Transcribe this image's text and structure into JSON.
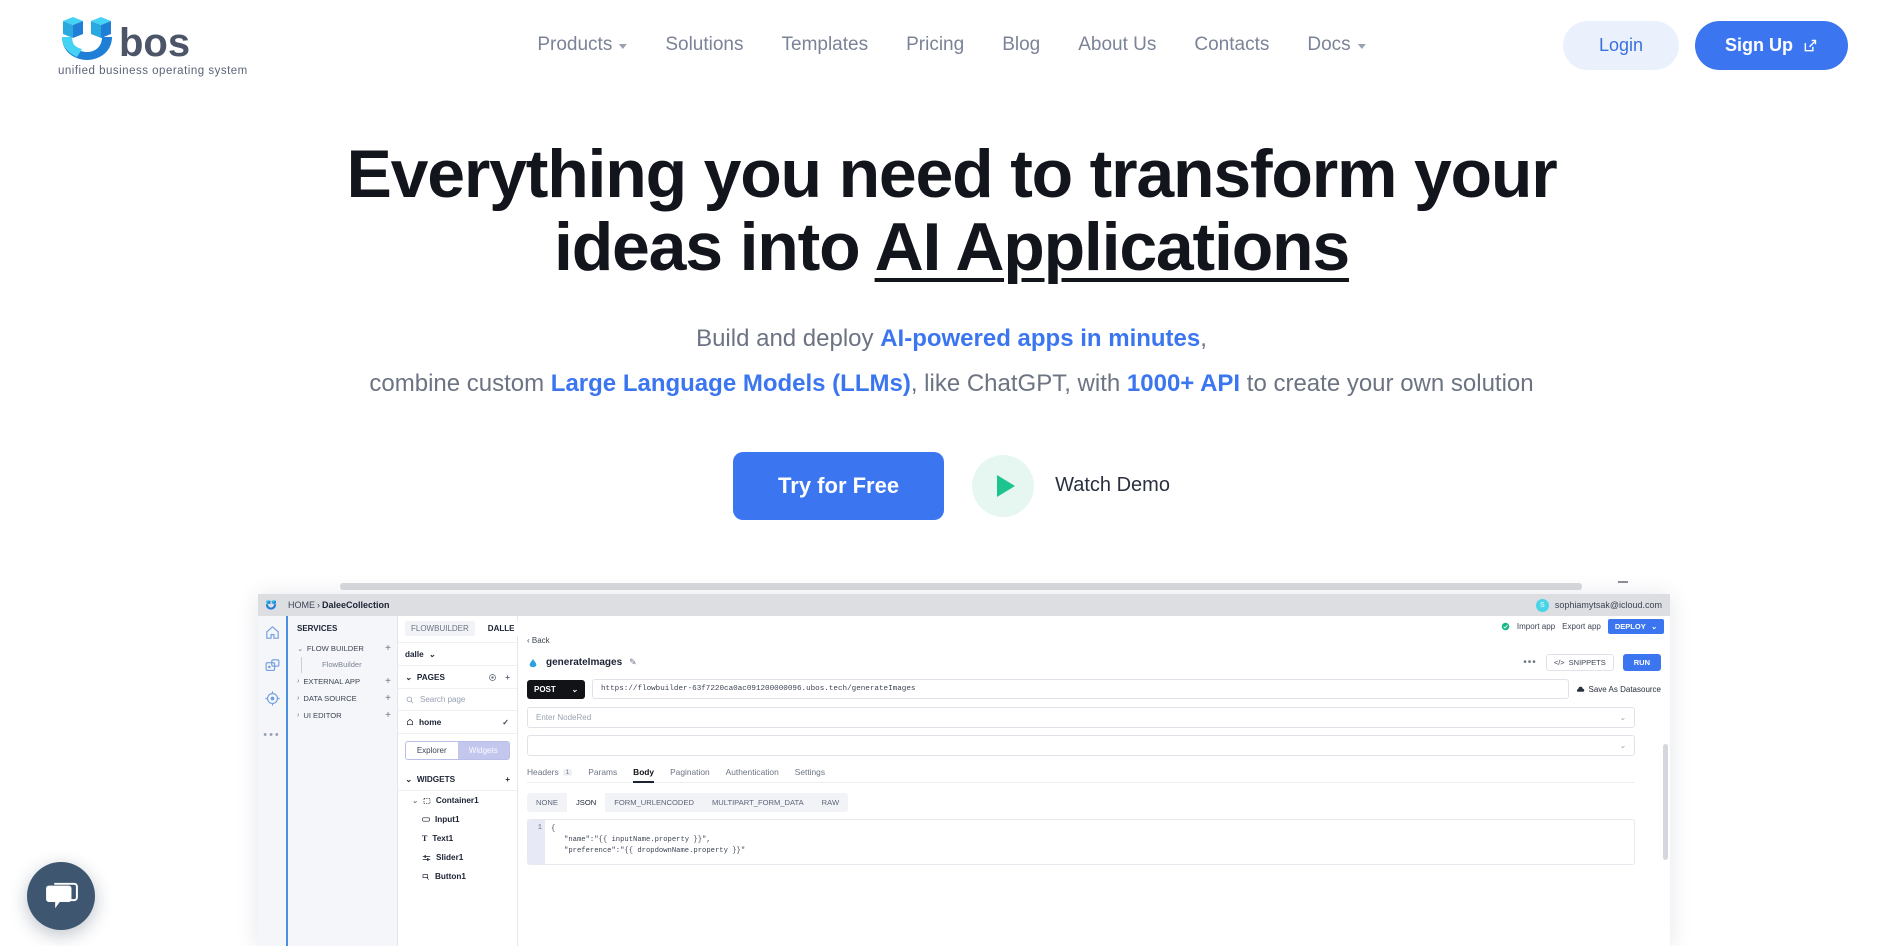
{
  "brand": {
    "name": "ubos",
    "tagline": "unified business operating system",
    "accent": "#3b76f0"
  },
  "nav": {
    "links": [
      {
        "label": "Products",
        "has_caret": true
      },
      {
        "label": "Solutions",
        "has_caret": false
      },
      {
        "label": "Templates",
        "has_caret": false
      },
      {
        "label": "Pricing",
        "has_caret": false
      },
      {
        "label": "Blog",
        "has_caret": false
      },
      {
        "label": "About Us",
        "has_caret": false
      },
      {
        "label": "Contacts",
        "has_caret": false
      },
      {
        "label": "Docs",
        "has_caret": true
      }
    ],
    "login_label": "Login",
    "signup_label": "Sign Up"
  },
  "hero": {
    "title_line1": "Everything you need to transform your",
    "title_line2_prefix": "ideas into ",
    "title_line2_underlined": "AI Applications",
    "sub_line1_a": "Build and deploy ",
    "sub_line1_b": "AI-powered apps in minutes",
    "sub_line1_c": ",",
    "sub_line2_a": "combine custom ",
    "sub_line2_b": "Large Language Models (LLMs)",
    "sub_line2_c": ", like ChatGPT, with ",
    "sub_line2_d": "1000+ API",
    "sub_line2_e": " to create your own solution",
    "cta_primary": "Try for Free",
    "cta_secondary": "Watch Demo"
  },
  "app_shot": {
    "breadcrumb_root": "HOME",
    "breadcrumb_sep": "›",
    "breadcrumb_current": "DaleeCollection",
    "user_initial": "S",
    "user_email": "sophiamytsak@icloud.com",
    "services_title": "SERVICES",
    "services": [
      {
        "label": "FLOW BUILDER",
        "expanded": true
      },
      {
        "label": "EXTERNAL APP",
        "expanded": false
      },
      {
        "label": "DATA SOURCE",
        "expanded": false
      },
      {
        "label": "UI EDITOR",
        "expanded": false
      }
    ],
    "services_child": "FlowBuilder",
    "tabs": [
      {
        "label": "FLOWBUILDER",
        "active": false
      },
      {
        "label": "DALLE",
        "active": true
      }
    ],
    "app_selector": "dalle",
    "toolbar": {
      "status_label": "",
      "import_label": "Import app",
      "export_label": "Export app",
      "deploy_label": "DEPLOY"
    },
    "pages_panel": {
      "title": "PAGES",
      "search_placeholder": "Search page",
      "page_item": "home",
      "seg_left": "Explorer",
      "seg_right": "Widgets",
      "widgets_title": "WIDGETS",
      "widgets": [
        {
          "label": "Container1",
          "icon": "container-icon",
          "child": false
        },
        {
          "label": "Input1",
          "icon": "input-icon",
          "child": true
        },
        {
          "label": "Text1",
          "icon": "text-icon",
          "child": true
        },
        {
          "label": "Slider1",
          "icon": "slider-icon",
          "child": true
        },
        {
          "label": "Button1",
          "icon": "button-icon",
          "child": true
        }
      ]
    },
    "main": {
      "back_label": "‹ Back",
      "endpoint_title": "generateImages",
      "snippets_label": "SNIPPETS",
      "run_label": "RUN",
      "method": "POST",
      "url": "https://flowbuilder-63f7220ca0ac091200000096.ubos.tech/generateImages",
      "save_datasource_label": "Save As Datasource",
      "nodered_placeholder": "Enter NodeRed",
      "second_select_value": "",
      "tabs": [
        {
          "label": "Headers",
          "badge": "1",
          "active": false
        },
        {
          "label": "Params",
          "badge": "",
          "active": false
        },
        {
          "label": "Body",
          "badge": "",
          "active": true
        },
        {
          "label": "Pagination",
          "badge": "",
          "active": false
        },
        {
          "label": "Authentication",
          "badge": "",
          "active": false
        },
        {
          "label": "Settings",
          "badge": "",
          "active": false
        }
      ],
      "body_types": [
        {
          "label": "NONE",
          "active": false
        },
        {
          "label": "JSON",
          "active": true
        },
        {
          "label": "FORM_URLENCODED",
          "active": false
        },
        {
          "label": "MULTIPART_FORM_DATA",
          "active": false
        },
        {
          "label": "RAW",
          "active": false
        }
      ],
      "code_line_number": "1",
      "code_line1": "{",
      "code_line2": "\"name\":\"{{ inputName.property }}\",",
      "code_line3": "\"preference\":\"{{ dropdownName.property }}\""
    }
  },
  "chat_widget": {
    "icon": "chat-bubble-icon"
  }
}
